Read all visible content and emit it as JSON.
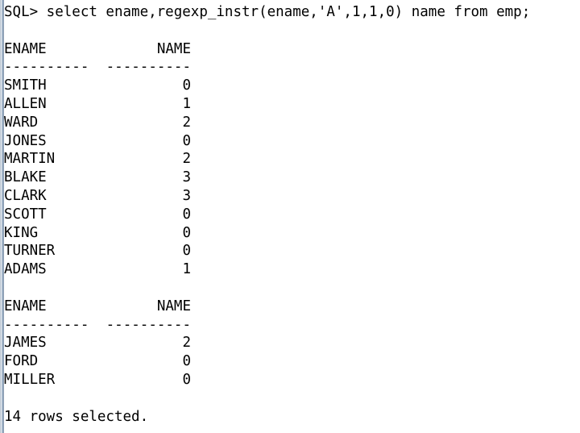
{
  "terminal": {
    "app": "SQL*Plus",
    "prompt": "SQL>",
    "background_color": "#ffffff",
    "text_color": "#000000",
    "gutter_color": "#9fb2c6",
    "command_line": "SQL> select ename,regexp_instr(ename,'A',1,1,0) name from emp;",
    "blank": " "
  },
  "result_block_1": {
    "headers": {
      "col1": "ENAME",
      "col2": "NAME"
    },
    "separator": {
      "col1": "----------",
      "col2": "----------"
    },
    "rows": [
      {
        "ename": "SMITH",
        "name": "0"
      },
      {
        "ename": "ALLEN",
        "name": "1"
      },
      {
        "ename": "WARD",
        "name": "2"
      },
      {
        "ename": "JONES",
        "name": "0"
      },
      {
        "ename": "MARTIN",
        "name": "2"
      },
      {
        "ename": "BLAKE",
        "name": "3"
      },
      {
        "ename": "CLARK",
        "name": "3"
      },
      {
        "ename": "SCOTT",
        "name": "0"
      },
      {
        "ename": "KING",
        "name": "0"
      },
      {
        "ename": "TURNER",
        "name": "0"
      },
      {
        "ename": "ADAMS",
        "name": "1"
      }
    ]
  },
  "result_block_2": {
    "headers": {
      "col1": "ENAME",
      "col2": "NAME"
    },
    "separator": {
      "col1": "----------",
      "col2": "----------"
    },
    "rows": [
      {
        "ename": "JAMES",
        "name": "2"
      },
      {
        "ename": "FORD",
        "name": "0"
      },
      {
        "ename": "MILLER",
        "name": "0"
      }
    ]
  },
  "footer": {
    "status": "14 rows selected."
  }
}
